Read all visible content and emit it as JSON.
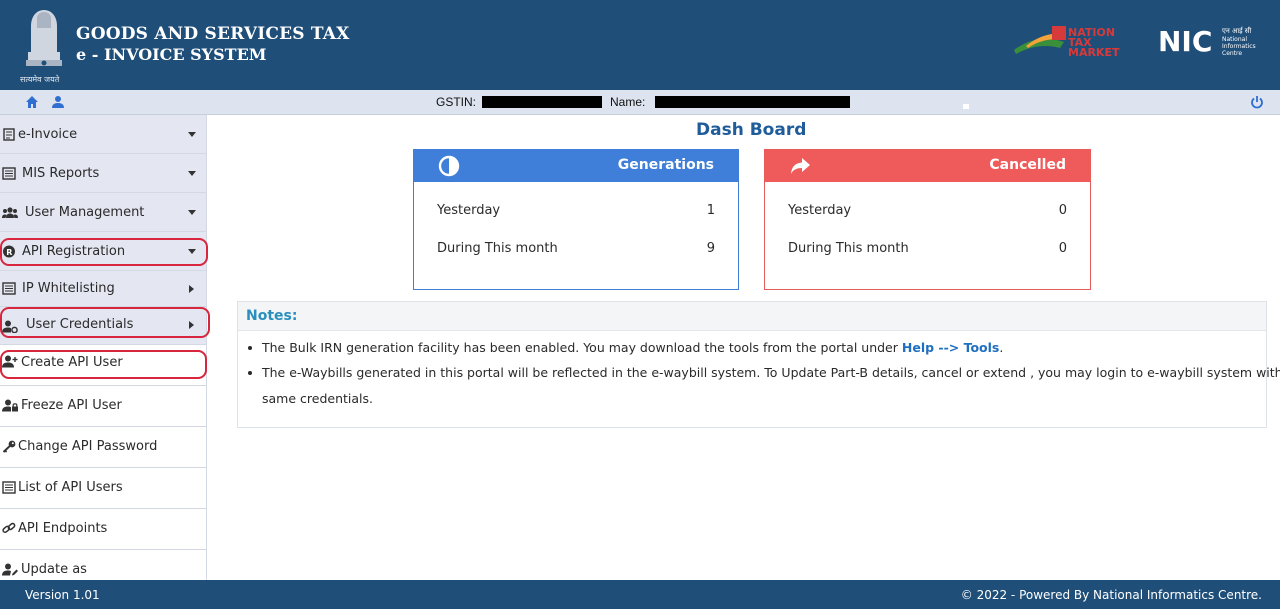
{
  "header": {
    "title_line1": "GOODS AND SERVICES TAX",
    "title_line2": "e - INVOICE SYSTEM",
    "emblem_motto": "सत्यमेव जयते",
    "logos": [
      "nation-tax-market-logo",
      "nic-logo"
    ]
  },
  "subbar": {
    "gstin_label": "GSTIN:",
    "name_label": "Name:",
    "icons": [
      "home-icon",
      "user-icon",
      "power-icon"
    ]
  },
  "sidebar": {
    "items": [
      {
        "label": "e-Invoice",
        "icon": "invoice-icon",
        "indicator": "caret-down"
      },
      {
        "label": "MIS Reports",
        "icon": "list-icon",
        "indicator": "caret-down"
      },
      {
        "label": "User Management",
        "icon": "users-icon",
        "indicator": "caret-down"
      },
      {
        "label": "API Registration",
        "icon": "registered-icon",
        "indicator": "caret-down"
      },
      {
        "label": "IP Whitelisting",
        "icon": "list-icon",
        "indicator": "caret-right"
      },
      {
        "label": "User Credentials",
        "icon": "user-cog-icon",
        "indicator": "caret-right"
      },
      {
        "label": "Create API User",
        "icon": "user-plus-icon"
      },
      {
        "label": "Freeze API User",
        "icon": "user-lock-icon"
      },
      {
        "label": "Change API Password",
        "icon": "key-icon"
      },
      {
        "label": "List of API Users",
        "icon": "list-icon"
      },
      {
        "label": "API Endpoints",
        "icon": "link-icon"
      },
      {
        "label": "Update as",
        "icon": "user-edit-icon"
      }
    ]
  },
  "main": {
    "title": "Dash Board",
    "cards": [
      {
        "label": "Generations",
        "icon": "half-circle-icon",
        "color": "#3f7fd9",
        "rows": [
          {
            "label": "Yesterday",
            "value": "1"
          },
          {
            "label": "During This month",
            "value": "9"
          }
        ]
      },
      {
        "label": "Cancelled",
        "icon": "share-arrow-icon",
        "color": "#ef5b5b",
        "rows": [
          {
            "label": "Yesterday",
            "value": "0"
          },
          {
            "label": "During This month",
            "value": "0"
          }
        ]
      }
    ],
    "notes": {
      "title": "Notes:",
      "note1_text": "The Bulk IRN generation facility has been enabled. You may download the tools from the portal under",
      "note1_link": "Help --> Tools",
      "note1_end": ".",
      "note2_line1": "The e-Waybills generated in this portal will be reflected in the e-waybill system. To Update Part-B details, cancel or extend , you may login to e-waybill system with",
      "note2_line2": "same credentials."
    }
  },
  "footer": {
    "version": "Version 1.01",
    "copyright": "© 2022 - Powered By National Informatics Centre."
  },
  "colors": {
    "brand": "#1f4e79",
    "accent_blue": "#3f7fd9",
    "accent_red": "#ef5b5b",
    "highlight_oval": "#d7263d"
  }
}
